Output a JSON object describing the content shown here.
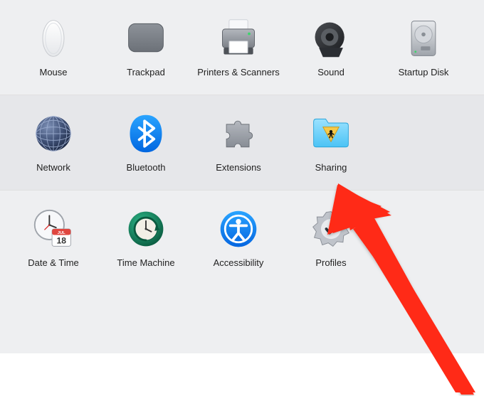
{
  "rows": [
    {
      "bg": "a",
      "items": [
        {
          "name": "mouse-prefpane",
          "icon": "mouse-icon",
          "label": "Mouse"
        },
        {
          "name": "trackpad-prefpane",
          "icon": "trackpad-icon",
          "label": "Trackpad"
        },
        {
          "name": "printers-scanners-prefpane",
          "icon": "printer-icon",
          "label": "Printers & Scanners"
        },
        {
          "name": "sound-prefpane",
          "icon": "speaker-icon",
          "label": "Sound"
        },
        {
          "name": "startup-disk-prefpane",
          "icon": "hdd-icon",
          "label": "Startup Disk"
        }
      ]
    },
    {
      "bg": "b",
      "items": [
        {
          "name": "network-prefpane",
          "icon": "globe-icon",
          "label": "Network"
        },
        {
          "name": "bluetooth-prefpane",
          "icon": "bluetooth-icon",
          "label": "Bluetooth"
        },
        {
          "name": "extensions-prefpane",
          "icon": "puzzle-icon",
          "label": "Extensions"
        },
        {
          "name": "sharing-prefpane",
          "icon": "sharing-icon",
          "label": "Sharing"
        }
      ]
    },
    {
      "bg": "a",
      "items": [
        {
          "name": "date-time-prefpane",
          "icon": "clock-cal-icon",
          "label": "Date & Time"
        },
        {
          "name": "time-machine-prefpane",
          "icon": "time-machine-icon",
          "label": "Time Machine"
        },
        {
          "name": "accessibility-prefpane",
          "icon": "accessibility-icon",
          "label": "Accessibility"
        },
        {
          "name": "profiles-prefpane",
          "icon": "profiles-icon",
          "label": "Profiles"
        }
      ]
    }
  ],
  "annotation": {
    "target": "sharing-prefpane"
  },
  "calendar": {
    "month": "JUL",
    "day": "18"
  }
}
